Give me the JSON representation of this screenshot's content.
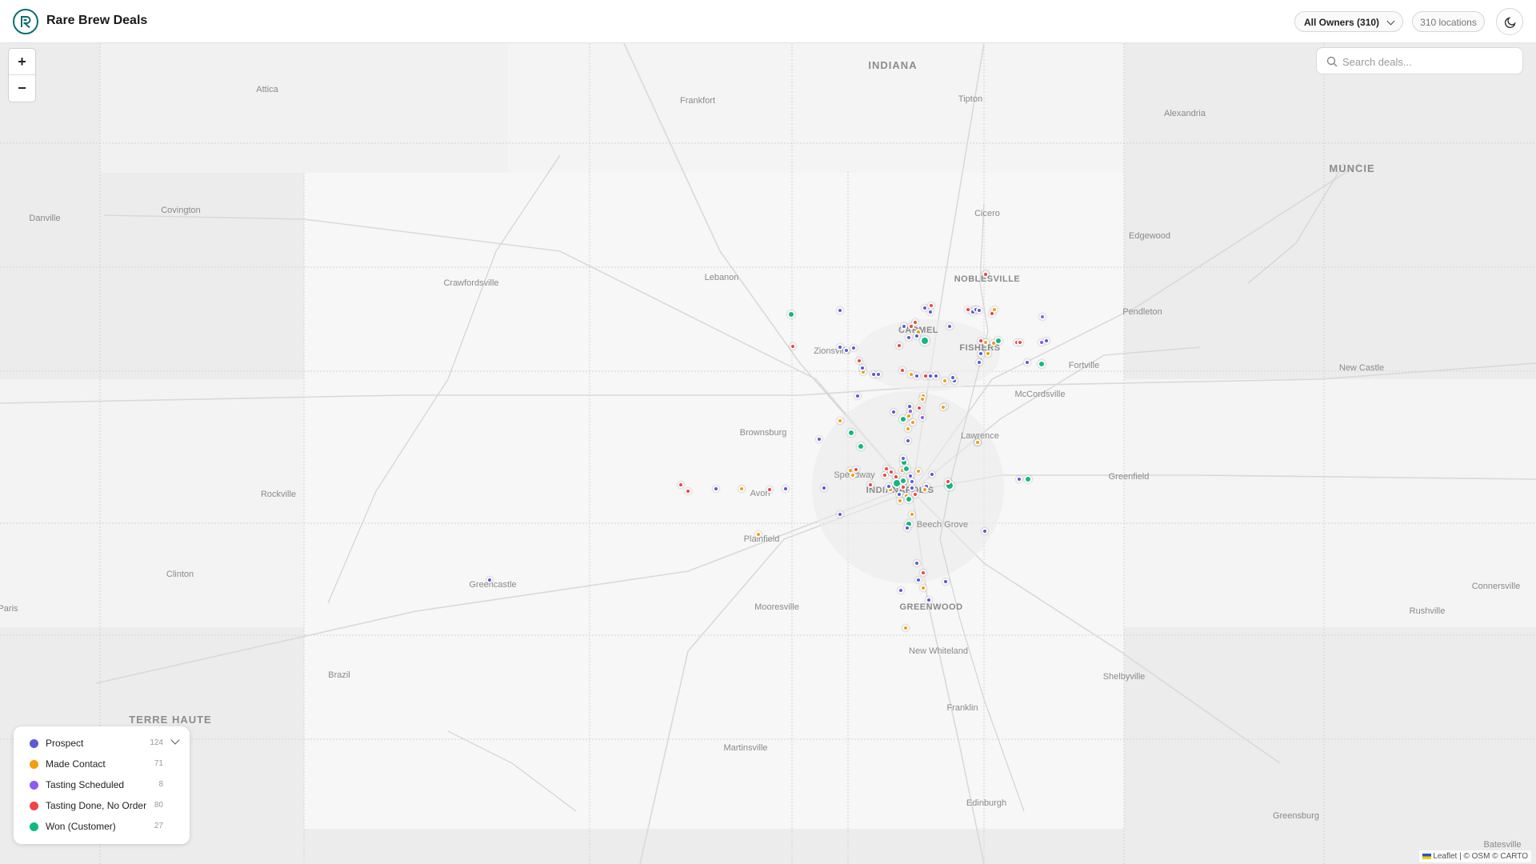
{
  "header": {
    "title": "Rare Brew Deals",
    "owner_filter": "All Owners (310)",
    "location_count": "310 locations"
  },
  "search": {
    "placeholder": "Search deals..."
  },
  "zoom": {
    "in_label": "+",
    "out_label": "−"
  },
  "legend": {
    "items": [
      {
        "label": "Prospect",
        "count": "124",
        "color": "#5b5bd6"
      },
      {
        "label": "Made Contact",
        "count": "71",
        "color": "#f59e0b"
      },
      {
        "label": "Tasting Scheduled",
        "count": "8",
        "color": "#8b5cf6"
      },
      {
        "label": "Tasting Done, No Order",
        "count": "80",
        "color": "#ef4444"
      },
      {
        "label": "Won (Customer)",
        "count": "27",
        "color": "#10b981"
      }
    ]
  },
  "map": {
    "places": [
      {
        "name": "INDIANA"
      },
      {
        "name": "Frankfort"
      },
      {
        "name": "Tipton"
      },
      {
        "name": "Alexandria"
      },
      {
        "name": "MUNCIE"
      },
      {
        "name": "Attica"
      },
      {
        "name": "Covington"
      },
      {
        "name": "Danville"
      },
      {
        "name": "Cicero"
      },
      {
        "name": "Edgewood"
      },
      {
        "name": "Crawfordsville"
      },
      {
        "name": "Lebanon"
      },
      {
        "name": "NOBLESVILLE"
      },
      {
        "name": "Pendleton"
      },
      {
        "name": "CARMEL"
      },
      {
        "name": "Zionsville"
      },
      {
        "name": "FISHERS"
      },
      {
        "name": "Fortville"
      },
      {
        "name": "New Castle"
      },
      {
        "name": "McCordsville"
      },
      {
        "name": "Brownsburg"
      },
      {
        "name": "Lawrence"
      },
      {
        "name": "Speedway"
      },
      {
        "name": "INDIANAPOLIS"
      },
      {
        "name": "Greenfield"
      },
      {
        "name": "Rockville"
      },
      {
        "name": "Avon"
      },
      {
        "name": "Beech Grove"
      },
      {
        "name": "Plainfield"
      },
      {
        "name": "Clinton"
      },
      {
        "name": "Greencastle"
      },
      {
        "name": "Connersville"
      },
      {
        "name": "Mooresville"
      },
      {
        "name": "GREENWOOD"
      },
      {
        "name": "Rushville"
      },
      {
        "name": "Paris"
      },
      {
        "name": "New Whiteland"
      },
      {
        "name": "Brazil"
      },
      {
        "name": "Shelbyville"
      },
      {
        "name": "Franklin"
      },
      {
        "name": "TERRE HAUTE"
      },
      {
        "name": "Martinsville"
      },
      {
        "name": "Edinburgh"
      },
      {
        "name": "Greensburg"
      },
      {
        "name": "Batesville"
      }
    ]
  },
  "attribution": {
    "leaflet": "Leaflet",
    "rest": " | © OSM © CARTO"
  }
}
